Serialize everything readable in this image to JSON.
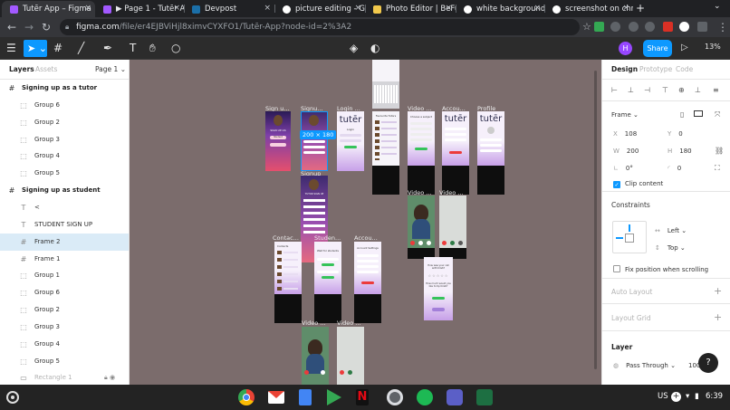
{
  "browser": {
    "tabs": [
      {
        "title": "Tutēr App – Figma",
        "icon": "figma-icon",
        "color": "#a259ff"
      },
      {
        "title": "▶ Page 1 - Tutēr A",
        "icon": "figma-icon",
        "color": "#a259ff"
      },
      {
        "title": "Devpost",
        "icon": "devpost-icon",
        "color": "#003e54"
      },
      {
        "title": "picture editing - Go",
        "icon": "google-icon",
        "color": "#ffffff"
      },
      {
        "title": "Photo Editor | BeFu",
        "icon": "befunky-icon",
        "color": "#f2c94c"
      },
      {
        "title": "white background",
        "icon": "google-icon",
        "color": "#ffffff"
      },
      {
        "title": "screenshot on chro",
        "icon": "google-icon",
        "color": "#ffffff"
      }
    ],
    "close_glyph": "×",
    "new_tab_glyph": "+",
    "caret_glyph": "⌄",
    "url_host": "figma.com",
    "url_path": "/file/er4EJBViHjl8ximvCYXFO1/Tutēr-App?node-id=2%3A2"
  },
  "figma": {
    "avatar_initial": "H",
    "share_label": "Share",
    "zoom_label": "13%",
    "left_panel": {
      "tabs": [
        "Layers",
        "Assets"
      ],
      "page": "Page 1 ⌄",
      "layers": [
        {
          "type": "frame",
          "label": "Signing up as a tutor",
          "indent": 0
        },
        {
          "type": "group",
          "label": "Group 6",
          "indent": 1
        },
        {
          "type": "group",
          "label": "Group 2",
          "indent": 1
        },
        {
          "type": "group",
          "label": "Group 3",
          "indent": 1
        },
        {
          "type": "group",
          "label": "Group 4",
          "indent": 1
        },
        {
          "type": "group",
          "label": "Group 5",
          "indent": 1
        },
        {
          "type": "frame",
          "label": "Signing up as student",
          "indent": 0
        },
        {
          "type": "text",
          "label": "<",
          "indent": 1
        },
        {
          "type": "text",
          "label": "STUDENT SIGN UP",
          "indent": 1
        },
        {
          "type": "frame-selected",
          "label": "Frame 2",
          "indent": 1
        },
        {
          "type": "frame-child",
          "label": "Frame 1",
          "indent": 1
        },
        {
          "type": "group",
          "label": "Group 1",
          "indent": 1
        },
        {
          "type": "group",
          "label": "Group 6",
          "indent": 1
        },
        {
          "type": "group",
          "label": "Group 2",
          "indent": 1
        },
        {
          "type": "group",
          "label": "Group 3",
          "indent": 1
        },
        {
          "type": "group",
          "label": "Group 4",
          "indent": 1
        },
        {
          "type": "group",
          "label": "Group 5",
          "indent": 1
        },
        {
          "type": "rect",
          "label": "Rectangle 1",
          "indent": 1
        }
      ]
    },
    "canvas": {
      "selection_size": "200 × 180",
      "frame_labels": [
        "Sign u...",
        "Signu...",
        "Login ...",
        "Video ...",
        "Accou...",
        "Profile",
        "Signup",
        "Video ...",
        "Video ...",
        "Contac...",
        "Studen...",
        "Accou...",
        "Video ...",
        "Video ..."
      ],
      "brand": "tutēr",
      "screen_text": [
        "SIGN UP AS",
        "Student",
        "TUTOR SIGN UP",
        "Login",
        "Favourite Tutors",
        "Choose a subject",
        "Account Settings",
        "Saved Classes",
        "Contacts",
        "Wait for students",
        "How was your call with Kristi?",
        "How much would you like to tip Kristi?"
      ]
    },
    "right_panel": {
      "tabs": [
        "Design",
        "Prototype",
        "Code"
      ],
      "frame_label": "Frame ⌄",
      "x": "108",
      "y": "0",
      "w": "200",
      "h": "180",
      "rotation": "0°",
      "radius": "0",
      "clip_content": "Clip content",
      "constraints": "Constraints",
      "constraint_h": "Left ⌄",
      "constraint_v": "Top ⌄",
      "fix_position": "Fix position when scrolling",
      "auto_layout": "Auto Layout",
      "layout_grid": "Layout Grid",
      "layer_title": "Layer",
      "pass_through": "Pass Through ⌄",
      "opacity": "100%"
    }
  },
  "shelf": {
    "keyboard": "US",
    "time": "6:39",
    "apps": [
      "chrome",
      "gmail",
      "docs",
      "play-store",
      "netflix",
      "camera",
      "spotify",
      "teams",
      "excel"
    ]
  }
}
